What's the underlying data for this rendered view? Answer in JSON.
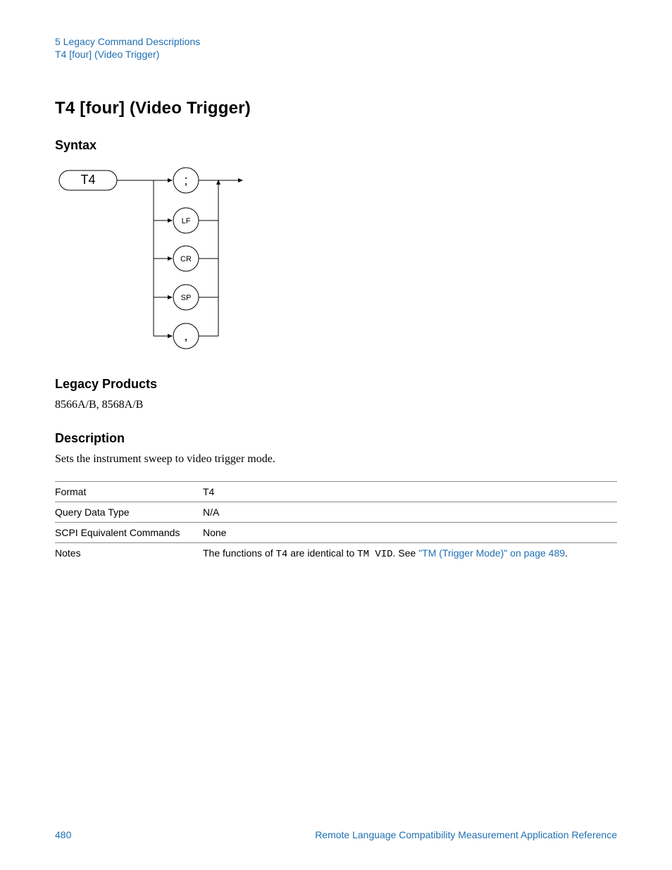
{
  "header": {
    "line1": "5  Legacy Command Descriptions",
    "line2": "T4 [four] (Video Trigger)"
  },
  "title": "T4 [four] (Video Trigger)",
  "sections": {
    "syntax": "Syntax",
    "legacy": "Legacy Products",
    "description": "Description"
  },
  "diagram": {
    "start": "T4",
    "terminators": [
      ";",
      "LF",
      "CR",
      "SP",
      ","
    ]
  },
  "legacy_products": "8566A/B, 8568A/B",
  "description_text": "Sets the instrument sweep to video trigger mode.",
  "table": {
    "rows": [
      {
        "label": "Format",
        "value": "T4",
        "mono": false
      },
      {
        "label": "Query Data Type",
        "value": "N/A",
        "mono": false
      },
      {
        "label": "SCPI Equivalent Commands",
        "value": "None",
        "mono": false
      }
    ],
    "notes": {
      "label": "Notes",
      "pre": "The functions of ",
      "code1": "T4",
      "mid": " are identical to ",
      "code2": "TM VID",
      "post": ". See ",
      "link": "\"TM (Trigger Mode)\" on page 489",
      "end": "."
    }
  },
  "footer": {
    "page": "480",
    "doc": "Remote Language Compatibility Measurement Application Reference"
  }
}
